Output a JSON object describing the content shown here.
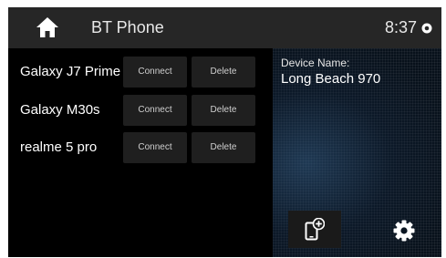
{
  "header": {
    "title": "BT Phone",
    "time": "8:37",
    "home_icon": "home-icon",
    "status_icon": "status-indicator-icon"
  },
  "devices": [
    {
      "name": "Galaxy J7 Prime",
      "connect_label": "Connect",
      "delete_label": "Delete"
    },
    {
      "name": "Galaxy M30s",
      "connect_label": "Connect",
      "delete_label": "Delete"
    },
    {
      "name": "realme 5 pro",
      "connect_label": "Connect",
      "delete_label": "Delete"
    }
  ],
  "side_panel": {
    "device_name_label": "Device Name:",
    "device_name_value": "Long Beach 970",
    "add_device_icon": "add-device-icon",
    "settings_icon": "gear-icon"
  },
  "colors": {
    "background": "#000000",
    "header": "#262626",
    "button": "#1f1f1f",
    "text": "#ffffff"
  }
}
